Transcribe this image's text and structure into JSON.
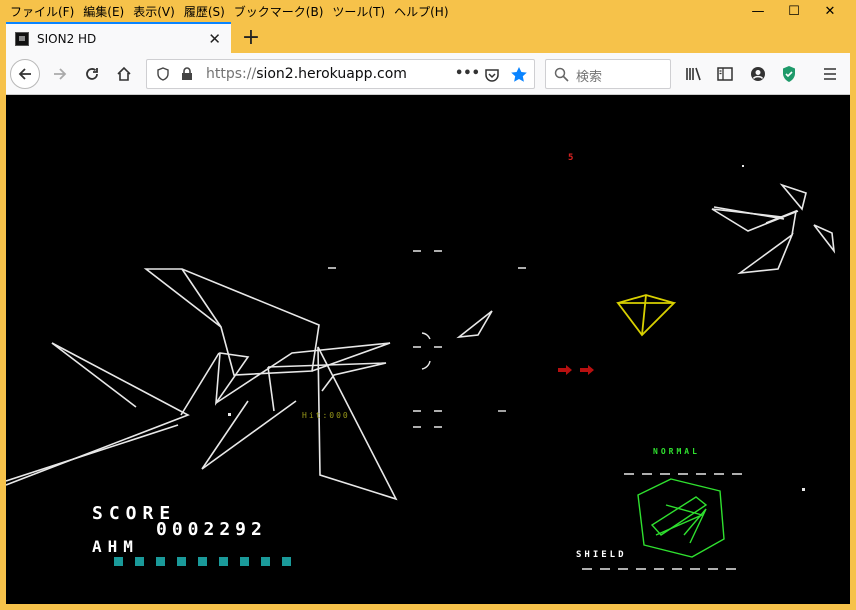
{
  "menu": [
    "ファイル(F)",
    "編集(E)",
    "表示(V)",
    "履歴(S)",
    "ブックマーク(B)",
    "ツール(T)",
    "ヘルプ(H)"
  ],
  "window_controls": {
    "minimize": "—",
    "maximize": "☐",
    "close": "✕"
  },
  "tab": {
    "title": "SION2 HD",
    "close": "✕"
  },
  "new_tab": "+",
  "toolbar": {
    "url_scheme": "https://",
    "url_host": "sion2.herokuapp.com",
    "page_actions": "•••",
    "search_placeholder": "検索"
  },
  "game": {
    "score_label": "SCORE",
    "score_value": "0002292",
    "weapon_label": "AHM",
    "weapon_ammo": 9,
    "mode": "NORMAL",
    "shield_label": "SHIELD",
    "hit_text": "Hit:000",
    "marker": "5"
  },
  "colors": {
    "accent": "#0a84ff",
    "frame": "#f6c24a",
    "hud_green": "#2fe02f",
    "ammo": "#1a9a9a",
    "enemy": "#d8d000",
    "missile": "#b81010"
  }
}
